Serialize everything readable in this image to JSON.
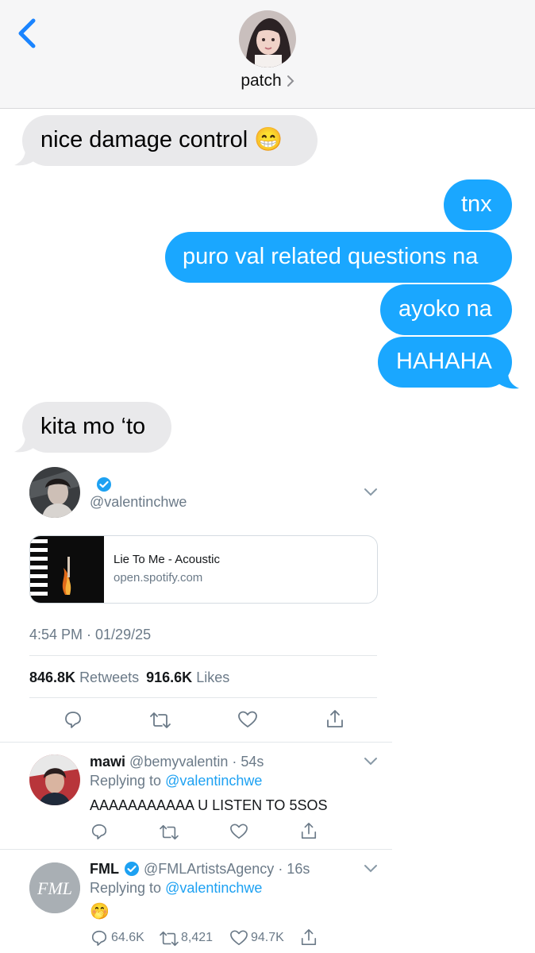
{
  "header": {
    "contact_name": "patch"
  },
  "messages": [
    {
      "dir": "received",
      "text": "nice damage control 😁"
    },
    {
      "dir": "sent",
      "text": "tnx"
    },
    {
      "dir": "sent",
      "text": "puro val related questions na"
    },
    {
      "dir": "sent",
      "text": "ayoko na"
    },
    {
      "dir": "sent",
      "text": "HAHAHA"
    },
    {
      "dir": "received",
      "text": "kita mo ‘to"
    }
  ],
  "tweet": {
    "handle": "@valentinchwe",
    "card_title": "Lie To Me - Acoustic",
    "card_domain": "open.spotify.com",
    "timestamp": "4:54 PM · 01/29/25",
    "retweets_count": "846.8K",
    "retweets_label": "Retweets",
    "likes_count": "916.6K",
    "likes_label": "Likes"
  },
  "replies": [
    {
      "name": "mawi",
      "meta": "@bemyvalentin · 54s",
      "replying_prefix": "Replying to",
      "replying_to": "@valentinchwe",
      "text": "AAAAAAAAAAA U LISTEN TO 5SOS"
    },
    {
      "name": "FML",
      "meta": "@FMLArtistsAgency · 16s",
      "replying_prefix": "Replying to",
      "replying_to": "@valentinchwe",
      "text": "🤭",
      "reply_count": "64.6K",
      "retweet_count": "8,421",
      "like_count": "94.7K",
      "avatar_text": "FML"
    }
  ],
  "colors": {
    "sent_bubble": "#1aa7ff",
    "received_bubble": "#e9e9eb",
    "ios_blue": "#1a84ff",
    "twitter_blue": "#1da1f2"
  }
}
